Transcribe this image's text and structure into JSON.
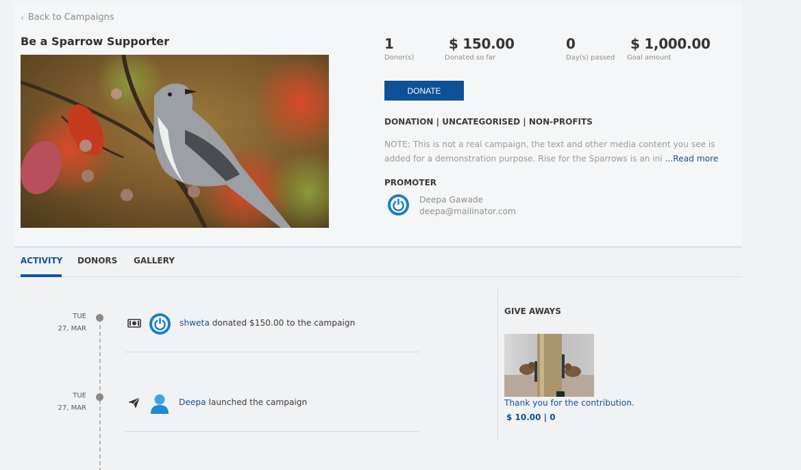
{
  "nav": {
    "back_label": "Back to Campaigns"
  },
  "campaign": {
    "title": "Be a Sparrow Supporter",
    "categories": "DONATION | UNCATEGORISED | NON-PROFITS",
    "note": "NOTE: This is not a real campaign, the text and other media content you see is added for a demonstration purpose.   Rise for the Sparrows is an ini ",
    "read_more": "...Read more",
    "donate_label": "DONATE"
  },
  "stats": [
    {
      "value": "1",
      "label": "Donor(s)"
    },
    {
      "value": "$ 150.00",
      "label": "Donated so far"
    },
    {
      "value": "0",
      "label": "Day(s) passed"
    },
    {
      "value": "$ 1,000.00",
      "label": "Goal amount"
    }
  ],
  "promoter": {
    "heading": "PROMOTER",
    "name": "Deepa Gawade",
    "email": "deepa@mailinator.com"
  },
  "tabs": [
    {
      "label": "ACTIVITY",
      "active": true
    },
    {
      "label": "DONORS",
      "active": false
    },
    {
      "label": "GALLERY",
      "active": false
    }
  ],
  "activity": [
    {
      "day": "TUE",
      "date": "27, MAR",
      "icon": "money-icon",
      "user": "shweta",
      "text": " donated $150.00 to the campaign"
    },
    {
      "day": "TUE",
      "date": "27, MAR",
      "icon": "paper-plane-icon",
      "user": "Deepa",
      "text": " launched the campaign"
    }
  ],
  "giveaways": {
    "heading": "GIVE AWAYS",
    "items": [
      {
        "title": "Thank you for the contribution.",
        "amount": "$ 10.00 | 0"
      }
    ]
  },
  "colors": {
    "accent": "#0d5297",
    "background": "#f1f2f4",
    "panel": "#f5f6f7"
  }
}
